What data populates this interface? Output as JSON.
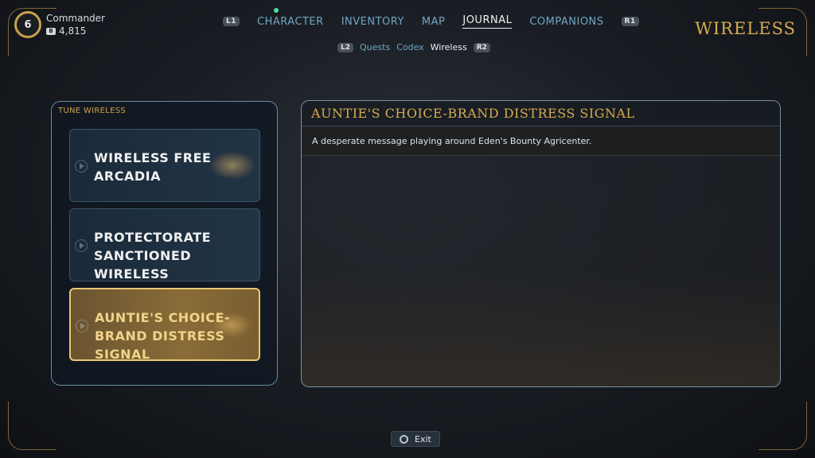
{
  "player": {
    "level": "6",
    "name": "Commander",
    "bits": "4,815"
  },
  "nav": {
    "left_bumper": "L1",
    "right_bumper": "R1",
    "tabs": [
      {
        "label": "CHARACTER"
      },
      {
        "label": "INVENTORY"
      },
      {
        "label": "MAP"
      },
      {
        "label": "JOURNAL"
      },
      {
        "label": "COMPANIONS"
      }
    ],
    "active_tab": "JOURNAL"
  },
  "subnav": {
    "left_trigger": "L2",
    "right_trigger": "R2",
    "items": [
      {
        "label": "Quests"
      },
      {
        "label": "Codex"
      },
      {
        "label": "Wireless"
      }
    ],
    "active": "Wireless"
  },
  "page_title": "WIRELESS",
  "left_panel": {
    "header": "TUNE WIRELESS",
    "stations": [
      {
        "label_line1": "WIRELESS FREE",
        "label_line2": "ARCADIA",
        "selected": false
      },
      {
        "label_line1": "PROTECTORATE",
        "label_line2": "SANCTIONED WIRELESS",
        "selected": false
      },
      {
        "label_line1": "AUNTIE'S CHOICE-",
        "label_line2": "BRAND DISTRESS SIGNAL",
        "selected": true
      }
    ]
  },
  "detail": {
    "title": "AUNTIE'S CHOICE-BRAND DISTRESS SIGNAL",
    "description": "A desperate message playing around Eden's Bounty Agricenter."
  },
  "footer": {
    "exit_label": "Exit"
  },
  "colors": {
    "gold": "#d8ab50",
    "nav_blue": "#6fa6c4",
    "selected_gold": "#e8c776"
  }
}
